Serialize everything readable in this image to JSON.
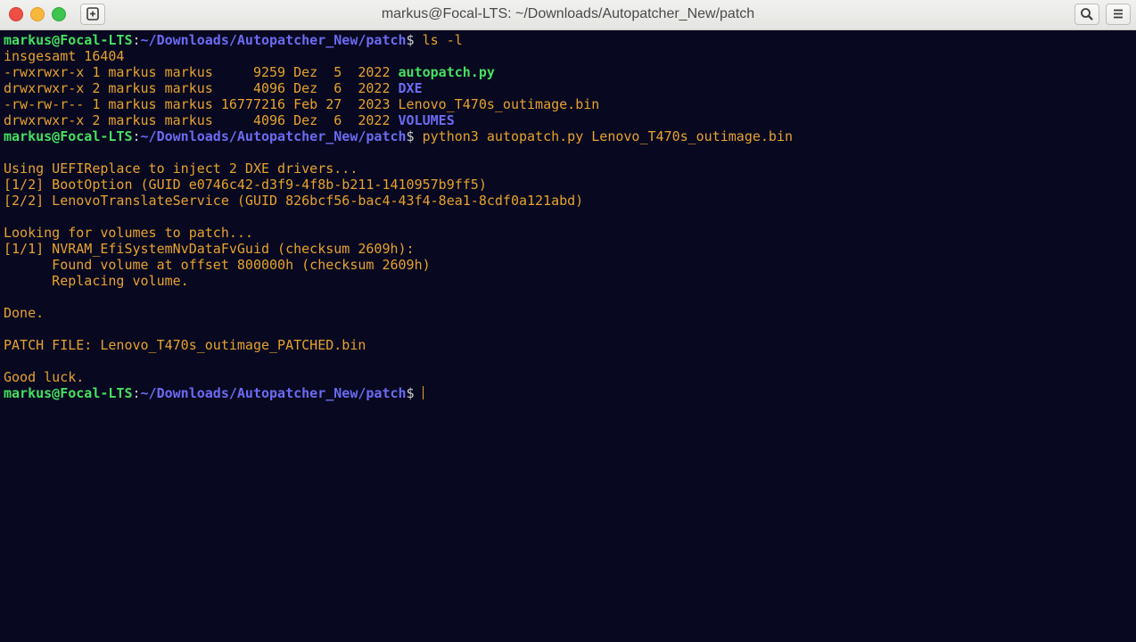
{
  "window": {
    "title": "markus@Focal-LTS: ~/Downloads/Autopatcher_New/patch"
  },
  "icons": {
    "close": "close-icon",
    "minimize": "minimize-icon",
    "maximize": "maximize-icon",
    "new_tab": "new-tab-icon",
    "search": "search-icon",
    "menu": "hamburger-menu-icon"
  },
  "colors": {
    "background": "#080820",
    "text": "#e6a22c",
    "prompt_user": "#45e060",
    "prompt_path": "#6b6bf2"
  },
  "prompt": {
    "user": "markus@Focal-LTS",
    "colon": ":",
    "path": "~/Downloads/Autopatcher_New/patch",
    "dollar": "$ "
  },
  "commands": {
    "ls": "ls -l",
    "python": "python3 autopatch.py Lenovo_T470s_outimage.bin"
  },
  "listing": {
    "total": "insgesamt 16404",
    "rows": [
      {
        "meta": "-rwxrwxr-x 1 markus markus     9259 Dez  5  2022 ",
        "name": "autopatch.py",
        "kind": "exe"
      },
      {
        "meta": "drwxrwxr-x 2 markus markus     4096 Dez  6  2022 ",
        "name": "DXE",
        "kind": "dir"
      },
      {
        "meta": "-rw-rw-r-- 1 markus markus 16777216 Feb 27  2023 ",
        "name": "Lenovo_T470s_outimage.bin",
        "kind": "file"
      },
      {
        "meta": "drwxrwxr-x 2 markus markus     4096 Dez  6  2022 ",
        "name": "VOLUMES",
        "kind": "dir"
      }
    ]
  },
  "output": {
    "lines": [
      "",
      "Using UEFIReplace to inject 2 DXE drivers...",
      "[1/2] BootOption (GUID e0746c42-d3f9-4f8b-b211-1410957b9ff5)",
      "[2/2] LenovoTranslateService (GUID 826bcf56-bac4-43f4-8ea1-8cdf0a121abd)",
      "",
      "Looking for volumes to patch...",
      "[1/1] NVRAM_EfiSystemNvDataFvGuid (checksum 2609h):",
      "      Found volume at offset 800000h (checksum 2609h)",
      "      Replacing volume.",
      "",
      "Done.",
      "",
      "PATCH FILE: Lenovo_T470s_outimage_PATCHED.bin",
      "",
      "Good luck."
    ]
  }
}
